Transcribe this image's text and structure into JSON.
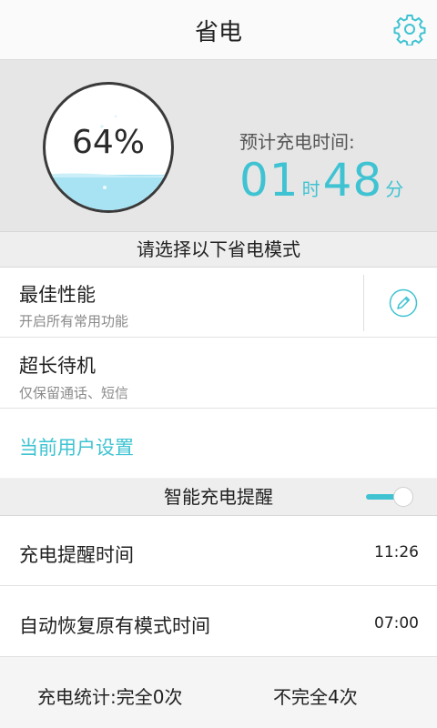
{
  "header": {
    "title": "省电"
  },
  "battery": {
    "percent_text": "64%",
    "level": 0.64
  },
  "estimate": {
    "label": "预计充电时间:",
    "hours": "01",
    "hours_unit": "时",
    "minutes": "48",
    "minutes_unit": "分"
  },
  "modes": {
    "header": "请选择以下省电模式",
    "items": [
      {
        "title": "最佳性能",
        "subtitle": "开启所有常用功能"
      },
      {
        "title": "超长待机",
        "subtitle": "仅保留通话、短信"
      }
    ],
    "custom_label": "当前用户设置"
  },
  "smart_charge": {
    "header": "智能充电提醒",
    "enabled": true
  },
  "settings": [
    {
      "label": "充电提醒时间",
      "value": "11:26"
    },
    {
      "label": "自动恢复原有模式时间",
      "value": "07:00"
    }
  ],
  "stats": {
    "full": "充电统计:完全0次",
    "partial": "不完全4次"
  },
  "colors": {
    "accent": "#3fc3d2",
    "water": "#a8e3f3"
  }
}
